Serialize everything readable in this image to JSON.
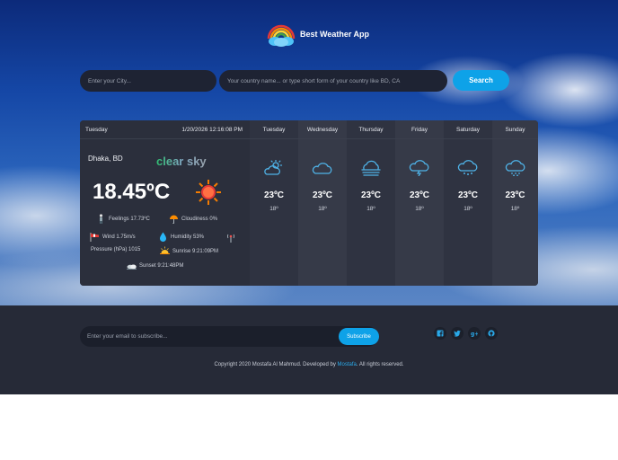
{
  "app": {
    "name": "Best Weather App"
  },
  "search": {
    "city_placeholder": "Enter your City...",
    "country_placeholder": "Your country name... or type short form of your country like BD, CA",
    "button_label": "Search"
  },
  "today": {
    "day": "Tuesday",
    "datetime": "1/20/2026 12:16:08 PM",
    "city": "Dhaka, BD",
    "description": "clear sky",
    "temperature": "18.45ºC",
    "feelings": "Feelings 17.73ºC",
    "cloudiness": "Cloudiness 0%",
    "wind": "Wind 1.75m/s",
    "humidity": "Humidity 53%",
    "pressure": "Pressure (hPa) 1015",
    "sunrise": "Sunrise 9:21:09PM",
    "sunset": "Sunset 9:21:48PM"
  },
  "forecast": [
    {
      "day": "Tuesday",
      "max": "23ºC",
      "min": "18º",
      "icon": "partly-sunny-icon"
    },
    {
      "day": "Wednesday",
      "max": "23ºC",
      "min": "18º",
      "icon": "cloud-icon"
    },
    {
      "day": "Thursday",
      "max": "23ºC",
      "min": "18º",
      "icon": "fog-icon"
    },
    {
      "day": "Friday",
      "max": "23ºC",
      "min": "18º",
      "icon": "thunder-cloud-icon"
    },
    {
      "day": "Saturday",
      "max": "23ºC",
      "min": "18º",
      "icon": "rain-cloud-icon"
    },
    {
      "day": "Sunday",
      "max": "23ºC",
      "min": "18º",
      "icon": "snow-cloud-icon"
    }
  ],
  "footer": {
    "email_placeholder": "Enter your email to subscribe...",
    "subscribe_label": "Subscribe",
    "copyright_prefix": "Copyright 2020 Mostafa Al Mahmud. Developed by ",
    "developer": "Mostafa",
    "copyright_suffix": ". All rights reserved."
  },
  "colors": {
    "accent": "#0ea2e8",
    "panel": "#2a2e3b",
    "footer": "#262a37"
  }
}
